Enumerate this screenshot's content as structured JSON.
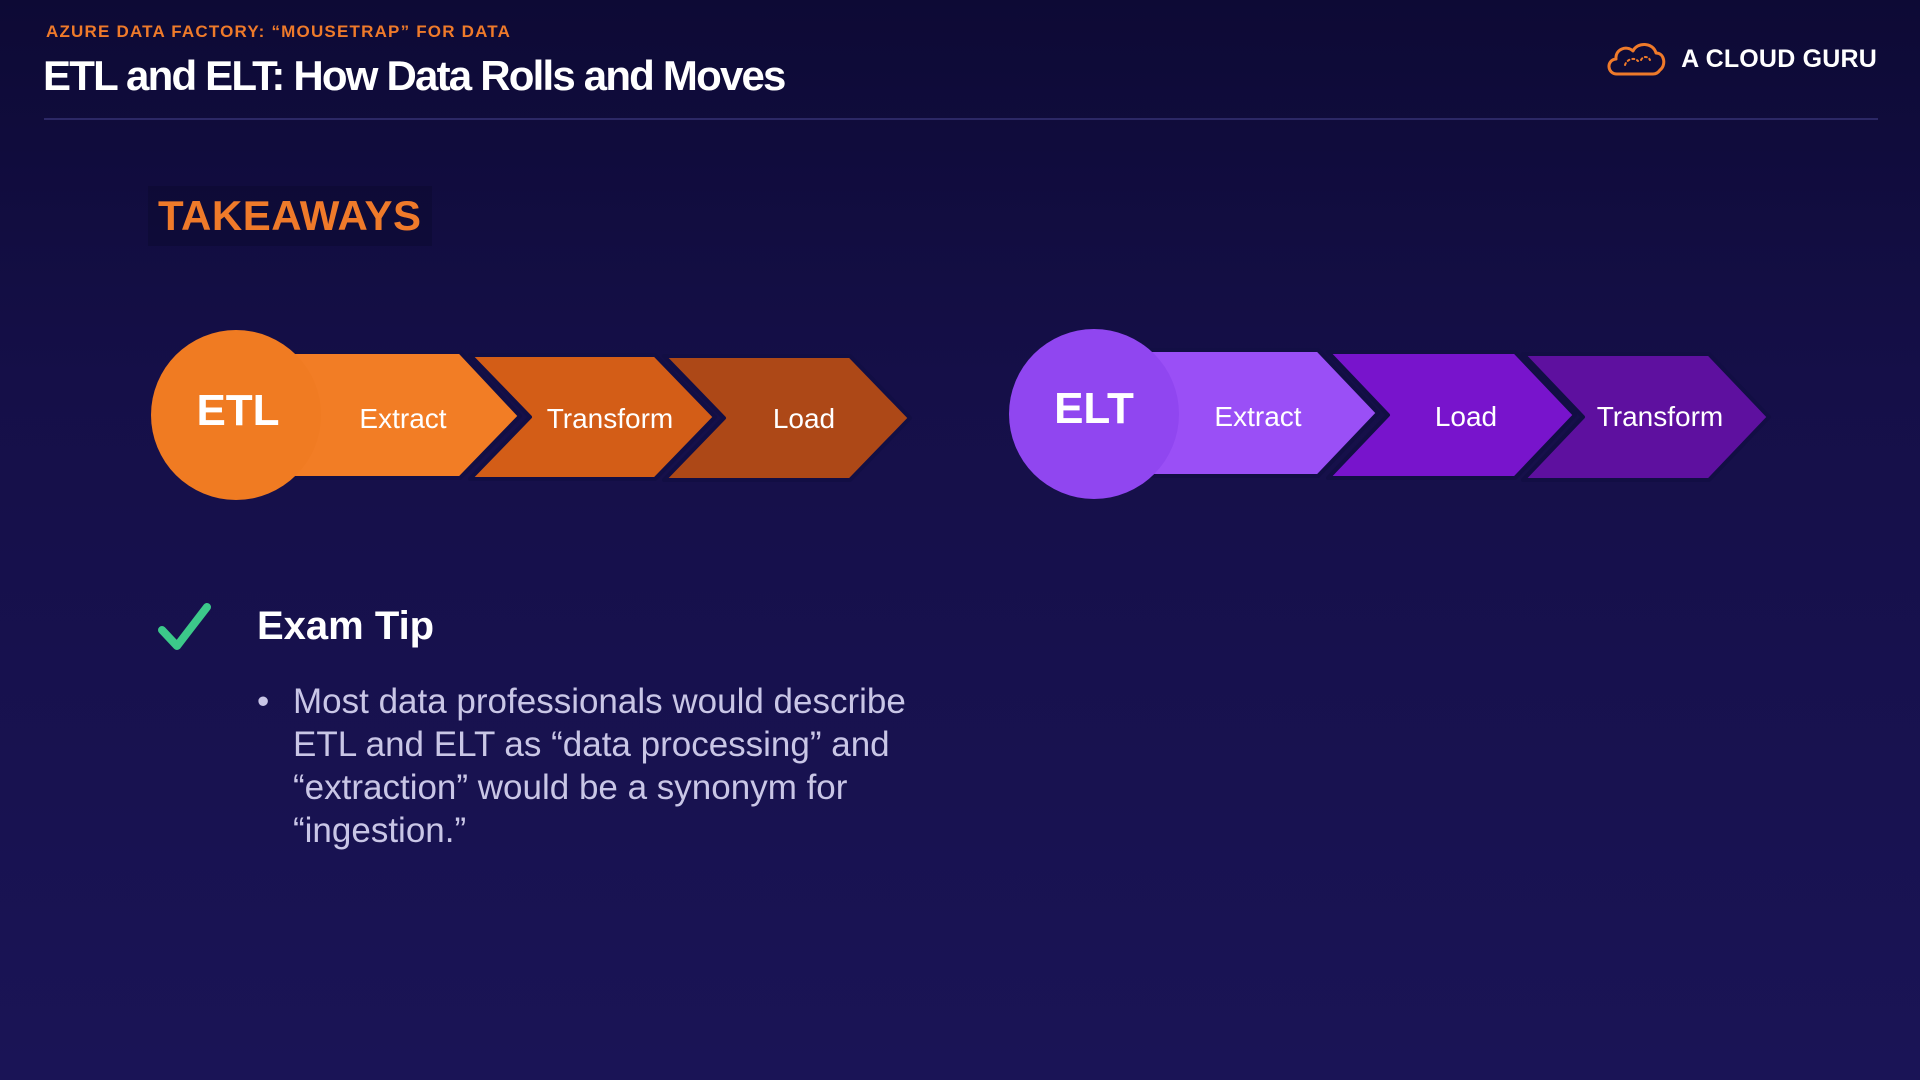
{
  "header": {
    "kicker": "AZURE DATA FACTORY: “MOUSETRAP” FOR DATA",
    "title": "ETL and ELT: How Data Rolls and Moves"
  },
  "brand": {
    "name": "A CLOUD GURU",
    "icon": "cloud-logo-icon"
  },
  "section": {
    "heading": "TAKEAWAYS"
  },
  "etl": {
    "label": "ETL",
    "steps": [
      "Extract",
      "Transform",
      "Load"
    ],
    "colors": [
      "#f07b22",
      "#f27d25",
      "#d35d17",
      "#ad4817"
    ]
  },
  "elt": {
    "label": "ELT",
    "steps": [
      "Extract",
      "Load",
      "Transform"
    ],
    "colors": [
      "#9046f0",
      "#9a4ff6",
      "#7814cc",
      "#5e109f"
    ]
  },
  "tip": {
    "icon": "checkmark-icon",
    "title": "Exam Tip",
    "bullets": [
      "Most data professionals would describe ETL and ELT as “data processing” and “extraction” would be a synonym for “ingestion.”"
    ]
  },
  "colors": {
    "accent_orange": "#ef7a2a",
    "check_green": "#3cc98a"
  }
}
